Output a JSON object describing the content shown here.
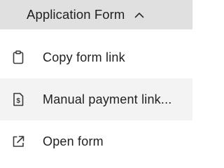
{
  "header": {
    "title": "Application Form",
    "chevron_icon": "chevron-up-icon"
  },
  "menu": {
    "items": [
      {
        "label": "Copy form link",
        "icon": "clipboard-icon"
      },
      {
        "label": "Manual payment link...",
        "icon": "payment-document-icon",
        "highlighted": true
      },
      {
        "label": "Open form",
        "icon": "external-link-icon"
      }
    ]
  },
  "colors": {
    "header_bg": "#e0e0e0",
    "highlight_bg": "#f3f3f3",
    "text": "#1f1f1f",
    "icon": "#3a3a3a"
  }
}
